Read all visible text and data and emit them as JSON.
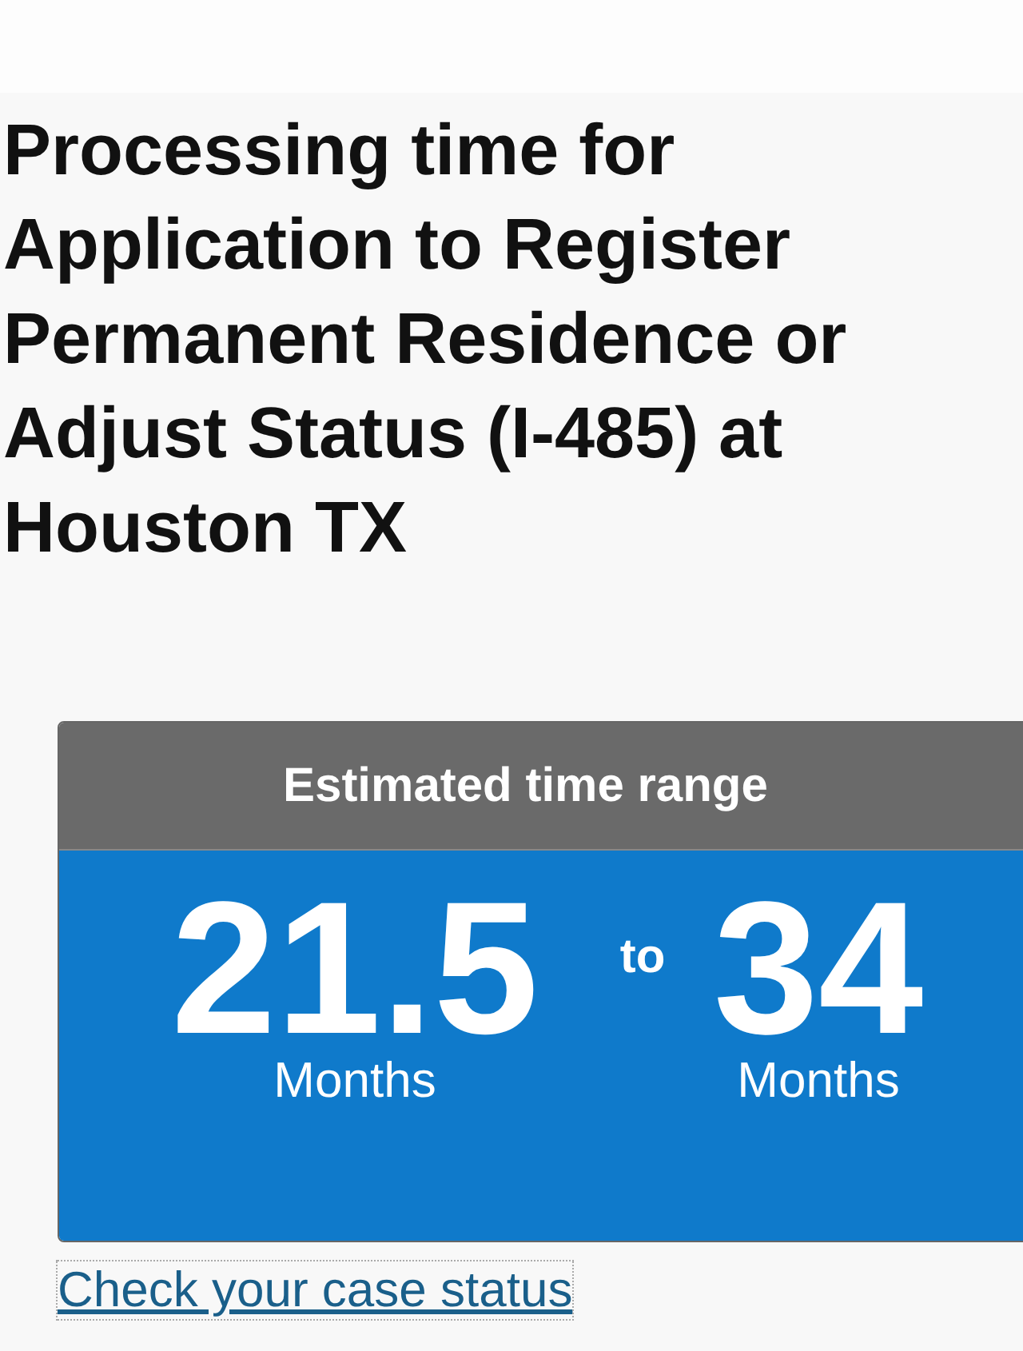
{
  "title": "Processing time for Application to Register Permanent Residence or Adjust Status (I-485) at Houston TX",
  "estimate": {
    "header": "Estimated time range",
    "from": {
      "value": "21.5",
      "unit": "Months"
    },
    "separator": "to",
    "to": {
      "value": "34",
      "unit": "Months"
    }
  },
  "link": "Check your case status"
}
